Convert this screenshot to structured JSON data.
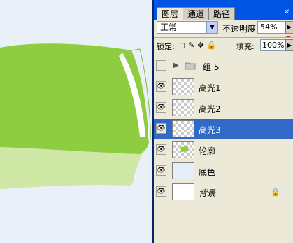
{
  "panel": {
    "tabs": [
      "图层",
      "通道",
      "路径"
    ],
    "close_glyph": "✕",
    "blend_mode": "正常",
    "opacity_label": "不透明度:",
    "opacity_value": "54%",
    "lock_label": "锁定:",
    "lock_icons": [
      "◻",
      "✎",
      "✥",
      "🔒"
    ],
    "fill_label": "填充:",
    "fill_value": "100%"
  },
  "layers": [
    {
      "name": "组 5",
      "type": "group",
      "visible": false
    },
    {
      "name": "高光1",
      "type": "transparent",
      "visible": true
    },
    {
      "name": "高光2",
      "type": "transparent",
      "visible": true
    },
    {
      "name": "高光3",
      "type": "transparent",
      "visible": true,
      "selected": true
    },
    {
      "name": "轮廓",
      "type": "shape",
      "visible": true
    },
    {
      "name": "底色",
      "type": "fill",
      "visible": true
    },
    {
      "name": "背景",
      "type": "background",
      "visible": true,
      "locked": true
    }
  ],
  "colors": {
    "accent": "#316ac5",
    "green": "#8dcd3f",
    "light_green": "#cfe8a6"
  }
}
